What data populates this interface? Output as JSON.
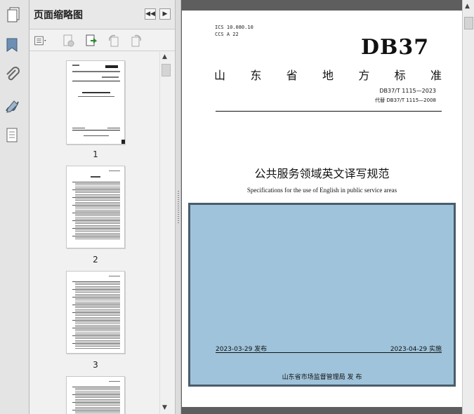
{
  "panel": {
    "title": "页面缩略图",
    "prev_btn": "◀◀",
    "next_btn": "▶"
  },
  "thumbnails": [
    {
      "number": "1"
    },
    {
      "number": "2"
    },
    {
      "number": "3"
    }
  ],
  "document": {
    "ics": "ICS  10.080.10",
    "ccs": "CCS  A  22",
    "logo": "DB37",
    "standard_type_chars": [
      "山",
      "东",
      "省",
      "地",
      "方",
      "标",
      "准"
    ],
    "code": "DB37/T 1115—2023",
    "replaces": "代替  DB37/T 1115—2008",
    "title_cn": "公共服务领域英文译写规范",
    "title_en": "Specifications for the use of English in public service areas",
    "issue_date": "2023-03-29 发布",
    "impl_date": "2023-04-29 实施",
    "issuer": "山东省市场监督管理局      发  布"
  },
  "colors": {
    "overlay": "#9fc3da",
    "overlay_border": "#4a5d6b",
    "viewer_bg": "#5e5e5e"
  },
  "icons": {
    "rail": [
      "pages-icon",
      "bookmark-icon",
      "attachment-icon",
      "signature-icon",
      "layers-icon"
    ],
    "toolbar": [
      "options-menu-icon",
      "delete-page-icon",
      "extract-page-icon",
      "rotate-ccw-icon",
      "rotate-cw-icon"
    ]
  }
}
